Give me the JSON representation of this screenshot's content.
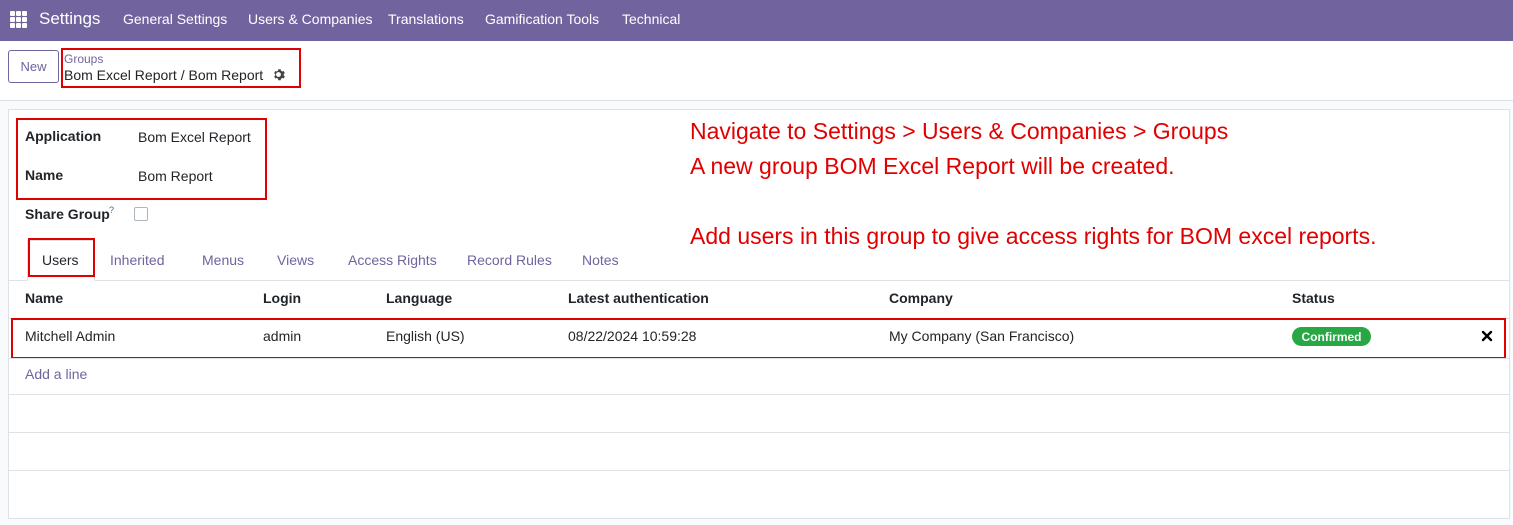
{
  "navbar": {
    "app_name": "Settings",
    "menu": [
      "General Settings",
      "Users & Companies",
      "Translations",
      "Gamification Tools",
      "Technical"
    ]
  },
  "control_panel": {
    "new_label": "New",
    "breadcrumb_parent": "Groups",
    "breadcrumb_current": "Bom Excel Report / Bom Report"
  },
  "form": {
    "application_label": "Application",
    "application_value": "Bom Excel Report",
    "name_label": "Name",
    "name_value": "Bom Report",
    "share_group_label": "Share Group",
    "share_group_help": "?",
    "share_group_checked": false
  },
  "tabs": [
    "Users",
    "Inherited",
    "Menus",
    "Views",
    "Access Rights",
    "Record Rules",
    "Notes"
  ],
  "active_tab": "Users",
  "table": {
    "columns": [
      "Name",
      "Login",
      "Language",
      "Latest authentication",
      "Company",
      "Status"
    ],
    "rows": [
      {
        "name": "Mitchell Admin",
        "login": "admin",
        "language": "English (US)",
        "latest_auth": "08/22/2024 10:59:28",
        "company": "My Company (San Francisco)",
        "status": "Confirmed"
      }
    ],
    "add_line": "Add a line"
  },
  "annotation": {
    "line1": "Navigate to Settings > Users & Companies > Groups",
    "line2": "A new group BOM Excel Report will be created.",
    "line3": "Add users in this group to give access rights for BOM excel reports."
  },
  "colors": {
    "brand": "#71639e",
    "annotation": "#e00000",
    "confirmed": "#28a745"
  }
}
